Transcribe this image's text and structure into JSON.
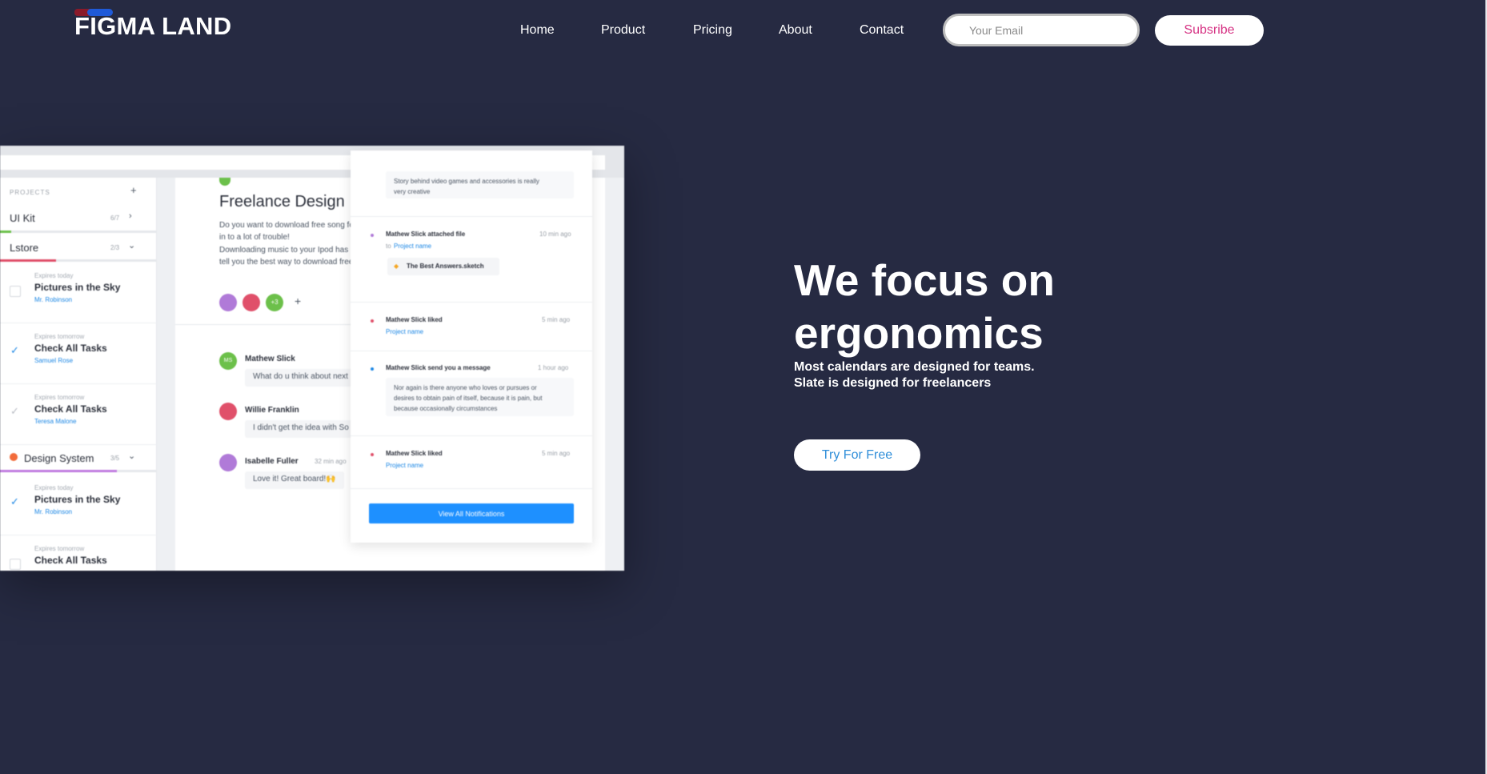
{
  "brand": {
    "name": "FIGMA LAND"
  },
  "nav": {
    "items": [
      {
        "label": "Home"
      },
      {
        "label": "Product"
      },
      {
        "label": "Pricing"
      },
      {
        "label": "About"
      },
      {
        "label": "Contact"
      }
    ],
    "email_placeholder": "Your Email",
    "subscribe_label": "Subsribe"
  },
  "mockup": {
    "sidebar": {
      "projects_header": "PROJECTS",
      "projects": [
        {
          "name": "UI Kit",
          "count": "6/7"
        },
        {
          "name": "Lstore",
          "count": "2/3"
        }
      ],
      "tasks_top": [
        {
          "expires": "Expires today",
          "title": "Pictures in the Sky",
          "assignee": "Mr. Robinson"
        },
        {
          "expires": "Expires tomorrow",
          "title": "Check All Tasks",
          "assignee": "Samuel Rose"
        },
        {
          "expires": "Expires tomorrow",
          "title": "Check All Tasks",
          "assignee": "Teresa Malone"
        }
      ],
      "group": {
        "name": "Design System",
        "count": "3/5"
      },
      "tasks_bottom": [
        {
          "expires": "Expires today",
          "title": "Pictures in the Sky",
          "assignee": "Mr. Robinson"
        },
        {
          "expires": "Expires tomorrow",
          "title": "Check All Tasks"
        }
      ]
    },
    "main": {
      "title": "Freelance Design",
      "body": [
        "Do you want to download free song fo",
        "in to a lot of trouble!",
        "Downloading music to your Ipod has",
        "tell you the best way to download free"
      ],
      "avatar_count": "+3",
      "comments": [
        {
          "name": "Mathew Slick",
          "text": "What do u think about next",
          "initials": "MS"
        },
        {
          "name": "Willie Franklin",
          "text": "I didn't get the idea with So"
        },
        {
          "name": "Isabelle Fuller",
          "time": "32 min ago",
          "text": "Love it! Great board!🙌"
        }
      ]
    },
    "notifications": {
      "top_text": [
        "Story behind video games and accessories is really",
        "very creative"
      ],
      "items": [
        {
          "title": "Mathew Slick attached file",
          "time": "10 min ago",
          "to_label": "to",
          "link": "Project name",
          "file": "The Best Answers.sketch"
        },
        {
          "title": "Mathew Slick liked",
          "time": "5 min ago",
          "link": "Project name"
        },
        {
          "title": "Mathew Slick send you a message",
          "time": "1 hour ago",
          "message": [
            "Nor again is there anyone who loves or pursues or",
            "desires to obtain pain of itself, because it is pain, but",
            "because occasionally circumstances"
          ]
        },
        {
          "title": "Mathew Slick liked",
          "time": "5 min ago",
          "link": "Project name"
        }
      ],
      "view_all_label": "View All Notifications"
    }
  },
  "hero": {
    "title_line1": "We focus on",
    "title_line2": "ergonomics",
    "subtitle_line1": "Most calendars are designed for teams.",
    "subtitle_line2": "Slate is designed for freelancers",
    "cta_label": "Try For Free"
  },
  "colors": {
    "background": "#262a42",
    "subscribe_text": "#d63384",
    "cta_text": "#2f8ed9",
    "link_blue": "#1e88e5",
    "button_blue": "#1e90ff"
  }
}
